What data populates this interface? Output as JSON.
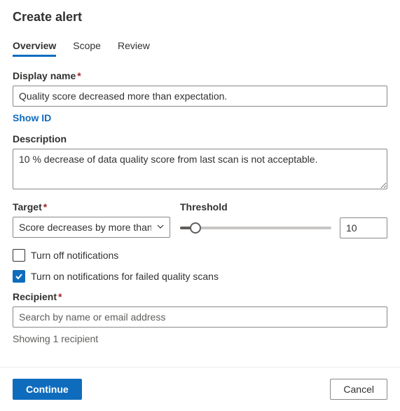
{
  "title": "Create alert",
  "tabs": {
    "overview": "Overview",
    "scope": "Scope",
    "review": "Review"
  },
  "display_name": {
    "label": "Display name",
    "required": "*",
    "value": "Quality score decreased more than expectation."
  },
  "show_id": "Show ID",
  "description": {
    "label": "Description",
    "value": "10 % decrease of data quality score from last scan is not acceptable."
  },
  "target": {
    "label": "Target",
    "required": "*",
    "selected": "Score decreases by more than"
  },
  "threshold": {
    "label": "Threshold",
    "value": "10"
  },
  "notifications": {
    "turn_off": "Turn off notifications",
    "turn_on_failed": "Turn on notifications for failed quality scans"
  },
  "recipient": {
    "label": "Recipient",
    "required": "*",
    "placeholder": "Search by name or email address",
    "showing": "Showing 1 recipient"
  },
  "footer": {
    "continue": "Continue",
    "cancel": "Cancel"
  }
}
